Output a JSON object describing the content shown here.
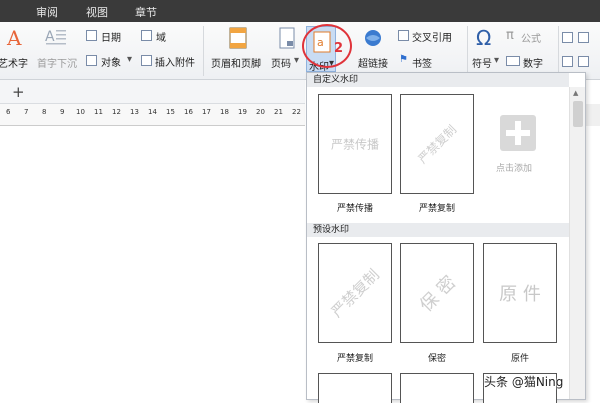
{
  "menu_tabs": [
    "审阅",
    "视图",
    "章节"
  ],
  "ribbon": {
    "art_text": "艺术字",
    "drop_cap": "首字下沉",
    "date": "日期",
    "field": "域",
    "object": "对象",
    "insert_attachment": "插入附件",
    "header_footer": "页眉和页脚",
    "page_number": "页码",
    "watermark": "水印",
    "hyperlink": "超链接",
    "cross_reference": "交叉引用",
    "bookmark": "书签",
    "symbol": "符号",
    "formula": "公式",
    "number": "数字"
  },
  "annotation": {
    "step_number": "2"
  },
  "tab_bar": {
    "add_symbol": "+"
  },
  "ruler_ticks": [
    "6",
    "7",
    "8",
    "9",
    "10",
    "11",
    "12",
    "13",
    "14",
    "15",
    "16",
    "17",
    "18",
    "19",
    "20",
    "21",
    "22"
  ],
  "dropdown": {
    "custom_section": "自定义水印",
    "preset_section": "预设水印",
    "custom_items": [
      {
        "watermark_text": "严禁传播",
        "label": "严禁传播"
      },
      {
        "watermark_text": "严禁复制",
        "label": "严禁复制"
      }
    ],
    "add_label": "点击添加",
    "preset_items": [
      {
        "watermark_text": "严禁复制",
        "label": "严禁复制"
      },
      {
        "watermark_text": "保 密",
        "label": "保密"
      },
      {
        "watermark_text": "原 件",
        "label": "原件"
      }
    ]
  },
  "credit": "头条 @猫Ning",
  "colors": {
    "highlight_red": "#e0333a",
    "menu_bg": "#3a3a3a",
    "selected_blue": "#c9dcf3"
  }
}
